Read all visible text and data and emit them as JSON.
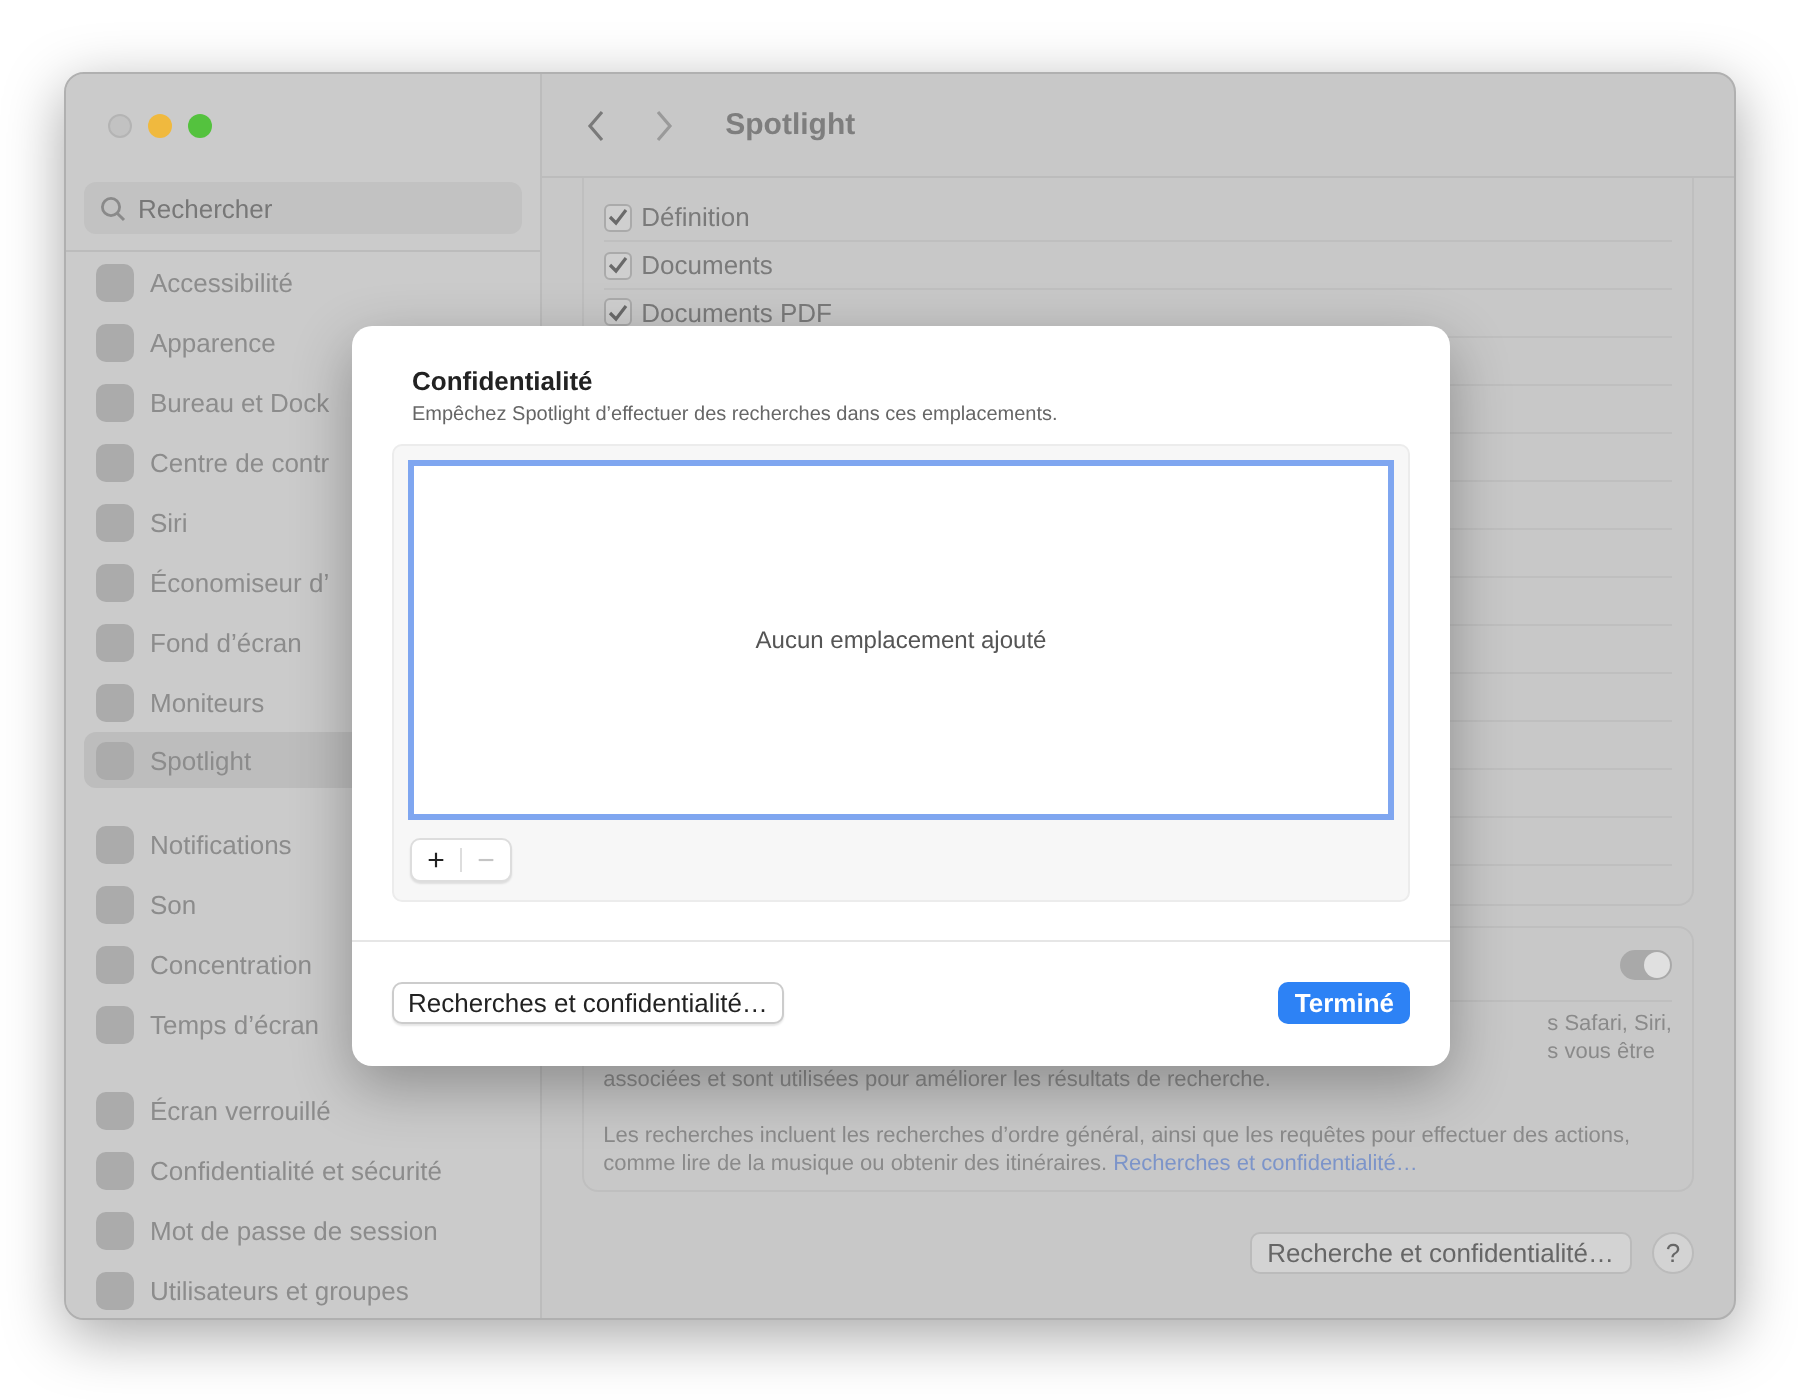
{
  "window": {
    "title": "Spotlight"
  },
  "sidebar": {
    "search": {
      "placeholder": "Rechercher"
    },
    "groups": [
      [
        {
          "label": "Accessibilité",
          "selected": false
        },
        {
          "label": "Apparence",
          "selected": false
        },
        {
          "label": "Bureau et Dock",
          "selected": false
        },
        {
          "label": "Centre de contr",
          "selected": false
        },
        {
          "label": "Siri",
          "selected": false
        },
        {
          "label": "Économiseur d’",
          "selected": false
        },
        {
          "label": "Fond d’écran",
          "selected": false
        },
        {
          "label": "Moniteurs",
          "selected": false
        },
        {
          "label": "Spotlight",
          "selected": true
        }
      ],
      [
        {
          "label": "Notifications",
          "selected": false
        },
        {
          "label": "Son",
          "selected": false
        },
        {
          "label": "Concentration",
          "selected": false
        },
        {
          "label": "Temps d’écran",
          "selected": false
        }
      ],
      [
        {
          "label": "Écran verrouillé",
          "selected": false
        },
        {
          "label": "Confidentialité et sécurité",
          "selected": false
        },
        {
          "label": "Mot de passe de session",
          "selected": false
        },
        {
          "label": "Utilisateurs et groupes",
          "selected": false
        }
      ]
    ]
  },
  "results": [
    {
      "label": "Définition",
      "checked": true
    },
    {
      "label": "Documents",
      "checked": true
    },
    {
      "label": "Documents PDF",
      "checked": true
    }
  ],
  "privacy_card": {
    "toggle_on": true,
    "text_lines": [
      "s Safari, Siri,",
      "s vous être",
      "associées et sont utilisées pour améliorer les résultats de recherche."
    ],
    "note": "Les recherches incluent les recherches d’ordre général, ainsi que les requêtes pour effectuer des actions, comme lire de la musique ou obtenir des itinéraires.",
    "link": "Recherches et confidentialité…"
  },
  "footer_button": "Recherche et confidentialité…",
  "help_label": "?",
  "sheet": {
    "title": "Confidentialité",
    "subtitle": "Empêchez Spotlight d’effectuer des recherches dans ces emplacements.",
    "empty_text": "Aucun emplacement ajouté",
    "add_label": "+",
    "remove_label": "−",
    "remove_disabled": true,
    "secondary_button": "Recherches et confidentialité…",
    "primary_button": "Terminé"
  }
}
